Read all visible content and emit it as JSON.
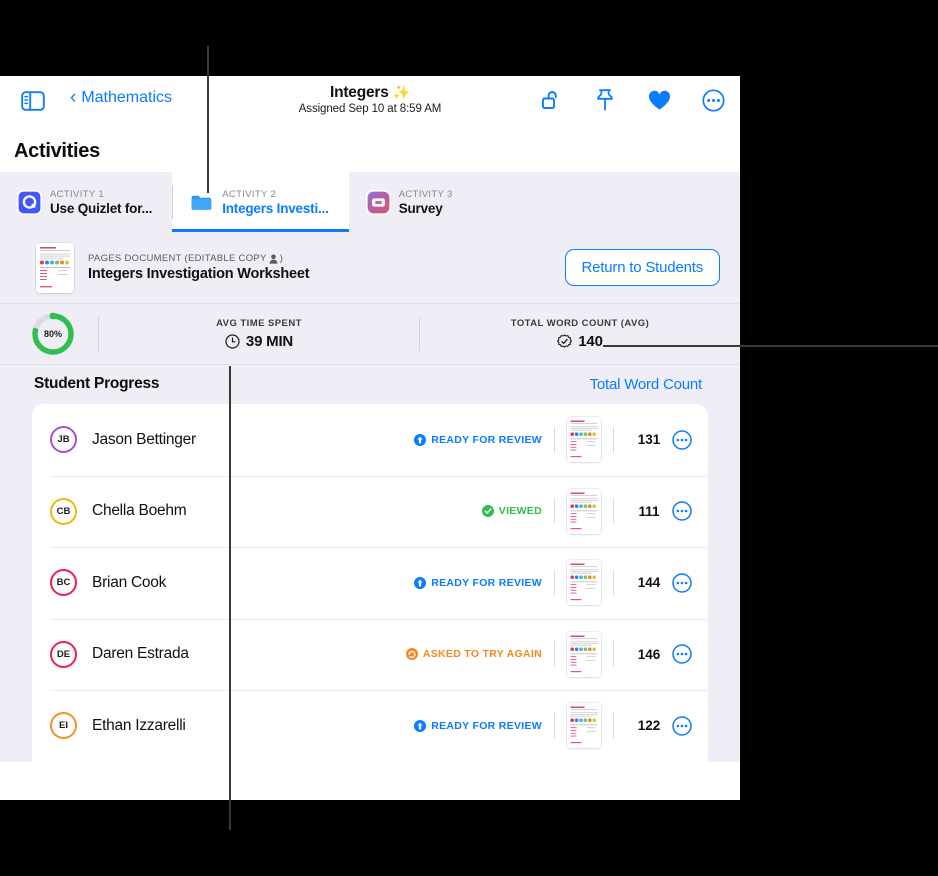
{
  "window": {
    "topbar": {
      "sidebar_toggle": "sidebar-toggle-icon",
      "back_label": "Mathematics",
      "title": "Integers",
      "title_emoji": "✨",
      "subtitle": "Assigned Sep 10 at 8:59 AM",
      "actions": [
        {
          "name": "unlock-icon",
          "label": "Unlock"
        },
        {
          "name": "pin-icon",
          "label": "Pin"
        },
        {
          "name": "heart-icon",
          "label": "Favorite"
        },
        {
          "name": "more-icon",
          "label": "More"
        }
      ]
    },
    "activities_heading": "Activities",
    "tabs": [
      {
        "kicker": "ACTIVITY 1",
        "label": "Use Quizlet for...",
        "icon": "quizlet-icon",
        "active": false
      },
      {
        "kicker": "ACTIVITY 2",
        "label": "Integers Investi...",
        "icon": "folder-icon",
        "active": true
      },
      {
        "kicker": "ACTIVITY 3",
        "label": "Survey",
        "icon": "survey-icon",
        "active": false
      }
    ],
    "document": {
      "kicker": "PAGES DOCUMENT (EDITABLE COPY ",
      "kicker_end": ")",
      "person_icon": "person-icon",
      "name": "Integers Investigation Worksheet",
      "return_button": "Return to Students"
    },
    "stats": {
      "ring_percent": "80%",
      "ring_value": 80,
      "ring_color": "#2fbe4f",
      "cells": [
        {
          "kicker": "AVG TIME SPENT",
          "value": "39 MIN",
          "icon": "clock-icon"
        },
        {
          "kicker": "TOTAL WORD COUNT (AVG)",
          "value": "140",
          "icon": "word-count-icon"
        }
      ]
    },
    "student_progress": {
      "title": "Student Progress",
      "link": "Total Word Count",
      "rows": [
        {
          "initials": "JB",
          "name": "Jason Bettinger",
          "avatar_color": "#a64fd6",
          "status": "READY FOR REVIEW",
          "status_kind": "ready",
          "status_color": "#0a7cff",
          "word_count": "131"
        },
        {
          "initials": "CB",
          "name": "Chella Boehm",
          "avatar_color": "#f2b705",
          "status": "VIEWED",
          "status_kind": "viewed",
          "status_color": "#2fbe4f",
          "word_count": "111"
        },
        {
          "initials": "BC",
          "name": "Brian Cook",
          "avatar_color": "#f01f52",
          "status": "READY FOR REVIEW",
          "status_kind": "ready",
          "status_color": "#0a7cff",
          "word_count": "144"
        },
        {
          "initials": "DE",
          "name": "Daren Estrada",
          "avatar_color": "#f01f52",
          "status": "ASKED TO TRY AGAIN",
          "status_kind": "retry",
          "status_color": "#f5871f",
          "word_count": "146"
        },
        {
          "initials": "EI",
          "name": "Ethan Izzarelli",
          "avatar_color": "#f59023",
          "status": "READY FOR REVIEW",
          "status_kind": "ready",
          "status_color": "#0a7cff",
          "word_count": "122"
        }
      ]
    }
  },
  "colors": {
    "accent": "#0a7cff",
    "panel_bg": "#efeef6",
    "green": "#2fbe4f",
    "orange": "#f5871f",
    "callout": "#3a3a3a",
    "page_bg": "#000000"
  }
}
